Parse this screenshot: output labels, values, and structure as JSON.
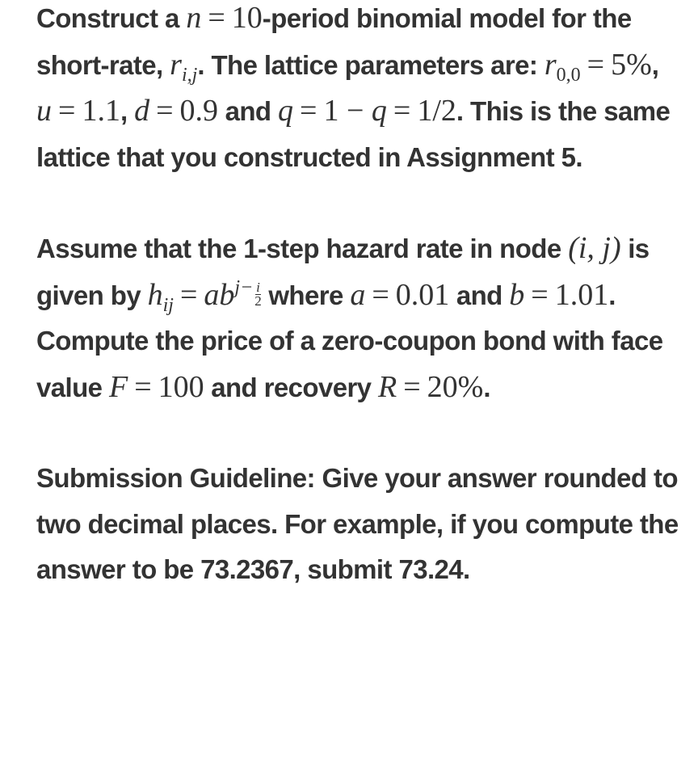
{
  "paragraphs": [
    {
      "segments": {
        "t1": "Construct a ",
        "m_n": "n",
        "m_eq": "=",
        "m_10": "10",
        "t2": "-period binomial model for the short-rate, ",
        "m_r": "r",
        "m_r_sub": "i,j",
        "t3": ". The lattice parameters are: ",
        "m_r00": "r",
        "m_r00_sub": "0,0",
        "m_eq2": "=",
        "m_5pct": "5%",
        "t4": ", ",
        "m_u": "u",
        "m_eq3": "=",
        "m_u_val": "1.1",
        "t5": ", ",
        "m_d": "d",
        "m_eq4": "=",
        "m_d_val": "0.9",
        "t6": " and ",
        "m_q": "q",
        "m_eq5": "=",
        "m_q_expr1": "1 − ",
        "m_q2": "q",
        "m_eq6": "=",
        "m_q_val": "1/2",
        "t7": ". This is the same lattice that you constructed in Assignment 5."
      }
    },
    {
      "segments": {
        "t1": "Assume that the 1-step hazard rate in node ",
        "m_node": "(i, j)",
        "t2": " is given by ",
        "m_h": "h",
        "m_h_sub": "ij",
        "m_eq": "=",
        "m_ab": "ab",
        "m_exp_j": "j−",
        "m_exp_num": "i",
        "m_exp_den": "2",
        "t3": " where ",
        "m_a": "a",
        "m_eq2": "=",
        "m_a_val": "0.01",
        "t4": " and ",
        "m_b": "b",
        "m_eq3": "=",
        "m_b_val": "1.01",
        "t5": ". Compute the price of a zero-coupon bond with face value ",
        "m_F": "F",
        "m_eq4": "=",
        "m_F_val": "100",
        "t6": " and recovery ",
        "m_R": "R",
        "m_eq5": "=",
        "m_R_val": "20%",
        "t7": "."
      }
    },
    {
      "text": "Submission Guideline: Give your answer rounded to two decimal places. For example, if you compute the answer to be 73.2367, submit 73.24."
    }
  ],
  "colors": {
    "text": "#333333",
    "background": "#ffffff"
  }
}
